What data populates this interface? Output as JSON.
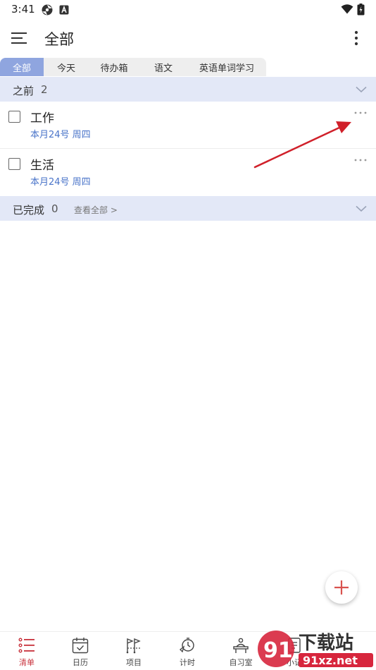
{
  "status_bar": {
    "time": "3:41"
  },
  "header": {
    "title": "全部"
  },
  "tabs": [
    {
      "label": "全部",
      "active": true
    },
    {
      "label": "今天",
      "active": false
    },
    {
      "label": "待办箱",
      "active": false
    },
    {
      "label": "语文",
      "active": false
    },
    {
      "label": "英语单词学习",
      "active": false
    }
  ],
  "groups": {
    "before": {
      "title": "之前",
      "count": "2"
    },
    "completed": {
      "title": "已完成",
      "count": "0",
      "link": "查看全部 >"
    }
  },
  "tasks": [
    {
      "title": "工作",
      "date": "本月24号 周四"
    },
    {
      "title": "生活",
      "date": "本月24号 周四"
    }
  ],
  "bottom_nav": [
    {
      "label": "清单",
      "icon": "list-icon",
      "active": true
    },
    {
      "label": "日历",
      "icon": "calendar-icon",
      "active": false
    },
    {
      "label": "项目",
      "icon": "project-icon",
      "active": false
    },
    {
      "label": "计时",
      "icon": "timer-icon",
      "active": false
    },
    {
      "label": "自习室",
      "icon": "study-room-icon",
      "active": false
    },
    {
      "label": "小记",
      "icon": "notes-icon",
      "active": false
    }
  ],
  "watermark": {
    "text1": "下载站",
    "text2": "91xz.net"
  },
  "colors": {
    "accent_tab": "#8fa5df",
    "group_bg": "#e3e8f7",
    "date_blue": "#4a74c9",
    "nav_active": "#c8323c",
    "annotation_arrow": "#d0202a"
  }
}
